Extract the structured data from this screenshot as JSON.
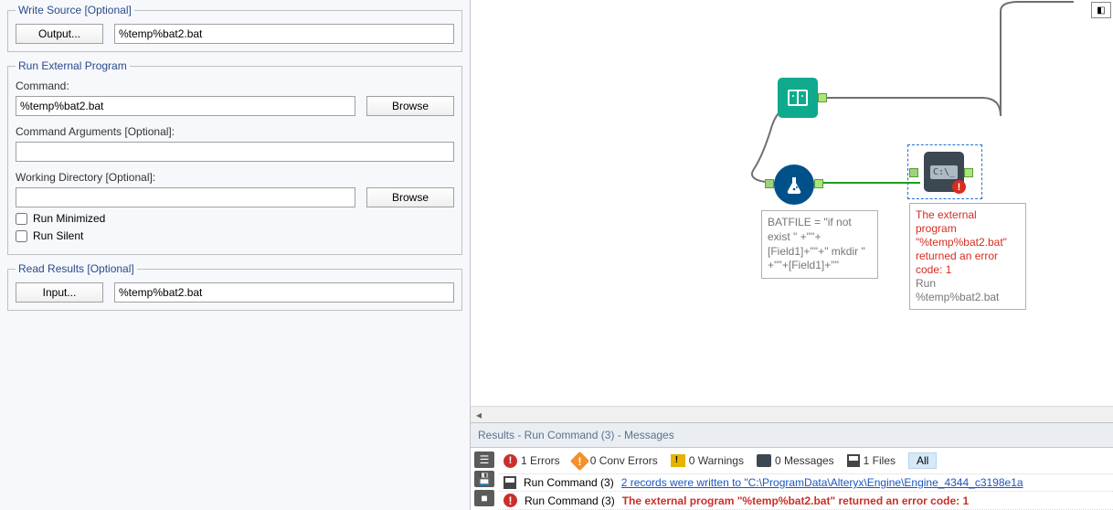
{
  "write_source": {
    "legend": "Write Source [Optional]",
    "button": "Output...",
    "value": "%temp%bat2.bat"
  },
  "run_external": {
    "legend": "Run External Program",
    "command_label": "Command:",
    "command_value": "%temp%bat2.bat",
    "browse": "Browse",
    "args_label": "Command Arguments [Optional]:",
    "args_value": "",
    "wd_label": "Working Directory [Optional]:",
    "wd_value": "",
    "run_minimized": "Run Minimized",
    "run_silent": "Run Silent"
  },
  "read_results": {
    "legend": "Read Results [Optional]",
    "button": "Input...",
    "value": "%temp%bat2.bat"
  },
  "canvas": {
    "formula_annotation": "BATFILE = \"if not exist \" +'\"'+[Field1]+'\"'+\" mkdir \" +'\"'+[Field1]+'\"'",
    "cmd_error": "The external program \"%temp%bat2.bat\" returned an error code: 1",
    "cmd_sub": "Run %temp%bat2.bat"
  },
  "results": {
    "header": "Results - Run Command (3) - Messages",
    "errors": "1 Errors",
    "conv_errors": "0 Conv Errors",
    "warnings": "0 Warnings",
    "messages": "0 Messages",
    "files": "1 Files",
    "all": "All",
    "row1_src": "Run Command (3)",
    "row1_msg": "2 records were written to \"C:\\ProgramData\\Alteryx\\Engine\\Engine_4344_c3198e1a",
    "row2_src": "Run Command (3)",
    "row2_msg": "The external program \"%temp%bat2.bat\" returned an error code: 1"
  }
}
